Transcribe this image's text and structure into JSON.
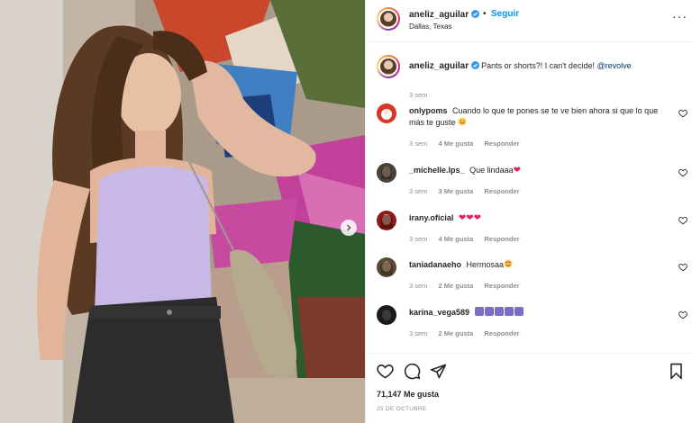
{
  "header": {
    "username": "aneliz_aguilar",
    "separator": "•",
    "follow_label": "Seguir",
    "location": "Dallas, Texas",
    "more_icon": "more-options-icon"
  },
  "caption": {
    "username": "aneliz_aguilar",
    "text": "Pants or shorts?! I can't decide!",
    "mention": "@revolve",
    "time": "3 sem"
  },
  "comments": [
    {
      "username": "onlypoms",
      "text": "Cuando lo que te pones se te ve bien ahora si que lo que más te guste",
      "time": "3 sem",
      "likes": "4 Me gusta",
      "reply": "Responder",
      "avatar_color": "#d8352b"
    },
    {
      "username": "_michelle.lps_",
      "text": "Que lindaaa",
      "time": "3 sem",
      "likes": "3 Me gusta",
      "reply": "Responder",
      "avatar_color": "#4a4238"
    },
    {
      "username": "irany.oficial",
      "text": "",
      "time": "3 sem",
      "likes": "4 Me gusta",
      "reply": "Responder",
      "avatar_color": "#8c1a1a"
    },
    {
      "username": "taniadanaeho",
      "text": "Hermosaa",
      "time": "3 sem",
      "likes": "2 Me gusta",
      "reply": "Responder",
      "avatar_color": "#5a4a32"
    },
    {
      "username": "karina_vega589",
      "text": "",
      "time": "3 sem",
      "likes": "2 Me gusta",
      "reply": "Responder",
      "avatar_color": "#1a1a1a"
    }
  ],
  "footer": {
    "likes": "71,147 Me gusta",
    "date": "25 DE OCTUBRE"
  },
  "colors": {
    "accent": "#0095f6",
    "verified": "#3897f0",
    "muted": "#8e8e8e",
    "text": "#262626"
  }
}
